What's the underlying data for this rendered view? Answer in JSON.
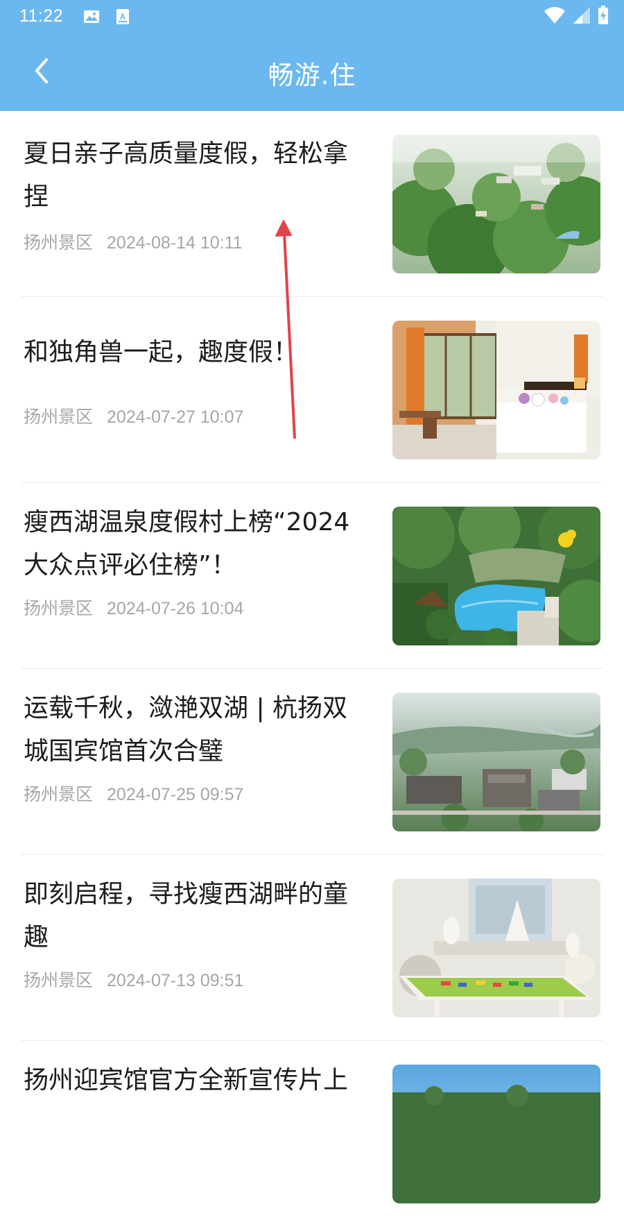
{
  "status_bar": {
    "time": "11:22",
    "icons": [
      "image-notification-icon",
      "text-notification-icon",
      "wifi-icon",
      "cell-signal-icon",
      "battery-charging-icon"
    ]
  },
  "app_bar": {
    "title": "畅游.住",
    "back_icon": "chevron-left-icon",
    "color": "#6bb8f1"
  },
  "articles": [
    {
      "title": "夏日亲子高质量度假，轻松拿捏",
      "source": "扬州景区",
      "date": "2024-08-14 10:11",
      "thumbnail": "aerial-forest-resort"
    },
    {
      "title": "和独角兽一起，趣度假！",
      "source": "扬州景区",
      "date": "2024-07-27 10:07",
      "thumbnail": "hotel-room-unicorn-toys"
    },
    {
      "title": "瘦西湖温泉度假村上榜“2024大众点评必住榜”！",
      "source": "扬州景区",
      "date": "2024-07-26 10:04",
      "thumbnail": "resort-pool-aerial"
    },
    {
      "title": "运载千秋，潋滟双湖 | 杭扬双城国宾馆首次合璧",
      "source": "扬州景区",
      "date": "2024-07-25 09:57",
      "thumbnail": "aerial-guesthouse-complex"
    },
    {
      "title": "即刻启程，寻找瘦西湖畔的童趣",
      "source": "扬州景区",
      "date": "2024-07-13 09:51",
      "thumbnail": "kids-playroom"
    },
    {
      "title": "扬州迎宾馆官方全新宣传片上",
      "source": "",
      "date": "",
      "thumbnail": "guesthouse-sky"
    }
  ],
  "overlay": {
    "gesture": "swipe-up-arrow",
    "color": "#e0434b"
  }
}
